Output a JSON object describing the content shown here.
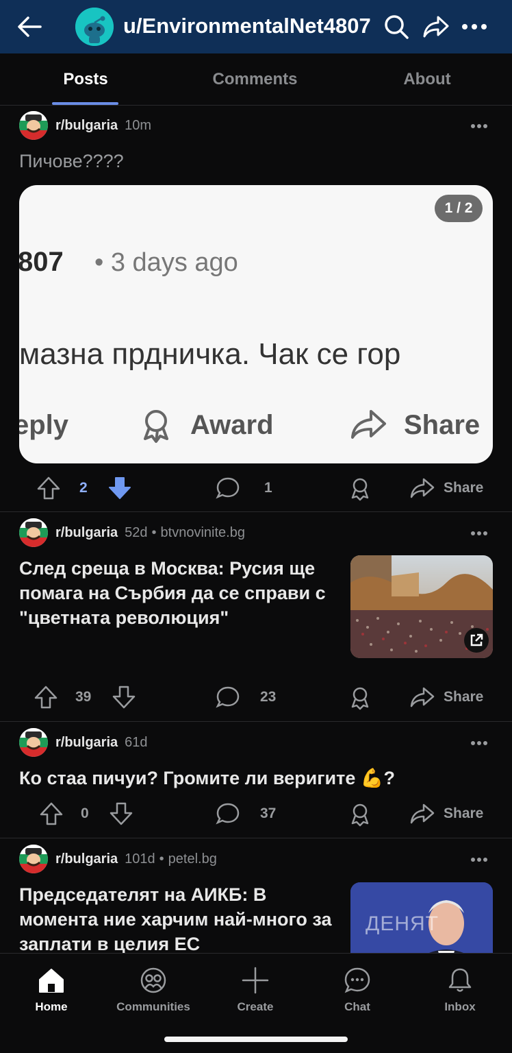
{
  "header": {
    "username": "u/EnvironmentalNet4807",
    "icons": [
      "back-arrow-icon",
      "search-icon",
      "share-icon",
      "more-icon"
    ]
  },
  "tabs": [
    {
      "label": "Posts",
      "active": true
    },
    {
      "label": "Comments",
      "active": false
    },
    {
      "label": "About",
      "active": false
    }
  ],
  "posts": [
    {
      "subreddit": "r/bulgaria",
      "age": "10m",
      "title": "Пичове????",
      "image": {
        "page_indicator": "1 / 2",
        "line1_left": "807",
        "line1_right": "• 3 days ago",
        "line2": "мазна прдничка. Чак се гор",
        "reply": "eply",
        "award": "Award",
        "share": "Share"
      },
      "votes": "2",
      "comments": "1",
      "share_label": "Share",
      "downvoted": true
    },
    {
      "subreddit": "r/bulgaria",
      "age": "52d",
      "separator": "•",
      "domain": "btvnovinite.bg",
      "title": "След среща в Москва: Русия ще помага на Сърбия да се справи с \"цветната революция\"",
      "votes": "39",
      "comments": "23",
      "share_label": "Share"
    },
    {
      "subreddit": "r/bulgaria",
      "age": "61d",
      "title": "Ко стаа пичуи? Громите ли веригите 💪?",
      "votes": "0",
      "comments": "37",
      "share_label": "Share"
    },
    {
      "subreddit": "r/bulgaria",
      "age": "101d",
      "separator": "•",
      "domain": "petel.bg",
      "title": "Председателят на АИКБ: В момента ние харчим най-много за заплати в целия ЕС",
      "thumb_text": "ДЕНЯТ"
    }
  ],
  "bottom_nav": [
    {
      "label": "Home",
      "icon": "home-icon",
      "active": true
    },
    {
      "label": "Communities",
      "icon": "communities-icon",
      "active": false
    },
    {
      "label": "Create",
      "icon": "plus-icon",
      "active": false
    },
    {
      "label": "Chat",
      "icon": "chat-icon",
      "active": false
    },
    {
      "label": "Inbox",
      "icon": "bell-icon",
      "active": false
    }
  ],
  "colors": {
    "header_bg": "#0f2f57",
    "accent": "#6a8de6",
    "downvote": "#6f98f0",
    "background": "#0b0b0c"
  }
}
